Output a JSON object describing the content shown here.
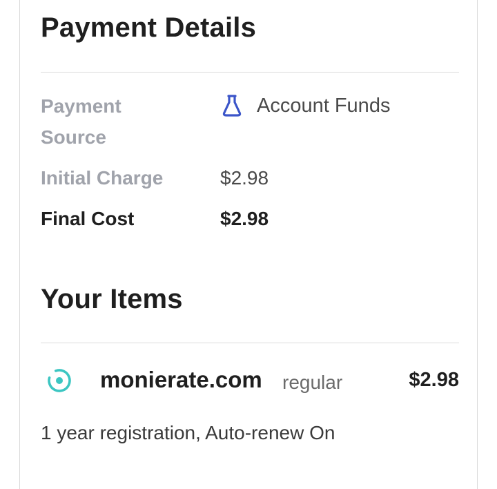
{
  "payment_details": {
    "title": "Payment Details",
    "source_label": "Payment Source",
    "source_value": "Account Funds",
    "source_icon": "bag-icon",
    "initial_charge_label": "Initial Charge",
    "initial_charge_value": "$2.98",
    "final_cost_label": "Final Cost",
    "final_cost_value": "$2.98"
  },
  "your_items": {
    "title": "Your Items",
    "items": [
      {
        "icon": "domain-status-icon",
        "domain": "monierate.com",
        "plan": "regular",
        "price": "$2.98",
        "description": "1 year registration, Auto-renew On"
      }
    ]
  },
  "colors": {
    "accent_blue": "#3b55c9",
    "teal": "#3cc6c2",
    "label_gray": "#a0a3ab"
  }
}
